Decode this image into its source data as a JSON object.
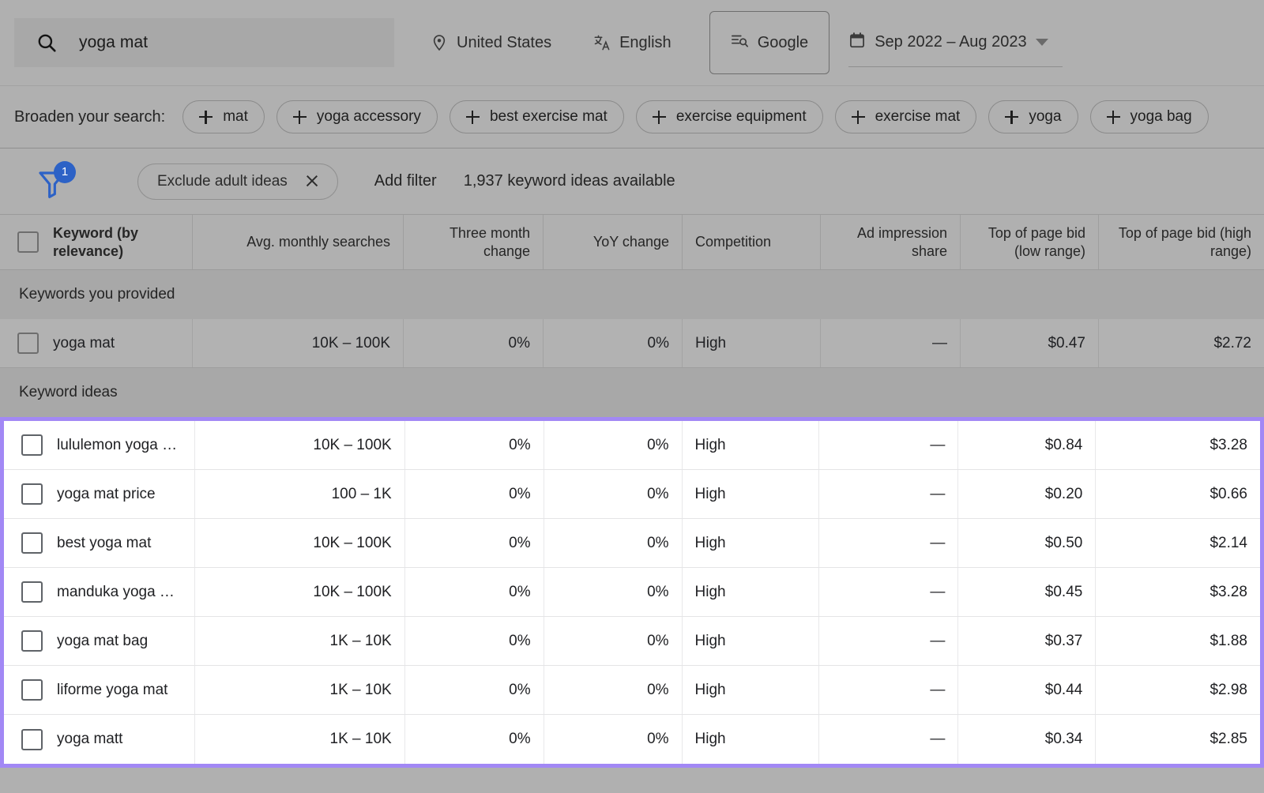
{
  "header": {
    "search": {
      "value": "yoga mat",
      "placeholder": "Enter a keyword",
      "icon": "search-icon"
    },
    "location": {
      "label": "United States",
      "icon": "location-pin-icon"
    },
    "language": {
      "label": "English",
      "icon": "translate-icon"
    },
    "engine": {
      "label": "Google",
      "icon": "search-network-icon"
    },
    "date_range": {
      "label": "Sep 2022 – Aug 2023",
      "icon": "calendar-icon",
      "caret": "chevron-down-icon"
    }
  },
  "broaden": {
    "label": "Broaden your search:",
    "chips": [
      "mat",
      "yoga accessory",
      "best exercise mat",
      "exercise equipment",
      "exercise mat",
      "yoga",
      "yoga bag"
    ]
  },
  "filters": {
    "funnel_icon": "filter-funnel-icon",
    "badge_count": "1",
    "active_chip": "Exclude adult ideas",
    "close_icon": "close-icon",
    "add_filter_label": "Add filter",
    "ideas_available": "1,937 keyword ideas available"
  },
  "table": {
    "columns": [
      "Keyword (by relevance)",
      "Avg. monthly searches",
      "Three month change",
      "YoY change",
      "Competition",
      "Ad impression share",
      "Top of page bid (low range)",
      "Top of page bid (high range)"
    ],
    "sections": [
      {
        "title": "Keywords you provided",
        "highlighted": false,
        "rows": [
          {
            "keyword": "yoga mat",
            "avg_monthly_searches": "10K – 100K",
            "three_month_change": "0%",
            "yoy_change": "0%",
            "competition": "High",
            "ad_impression_share": "—",
            "bid_low": "$0.47",
            "bid_high": "$2.72"
          }
        ]
      },
      {
        "title": "Keyword ideas",
        "highlighted": true,
        "rows": [
          {
            "keyword": "lululemon yoga …",
            "avg_monthly_searches": "10K – 100K",
            "three_month_change": "0%",
            "yoy_change": "0%",
            "competition": "High",
            "ad_impression_share": "—",
            "bid_low": "$0.84",
            "bid_high": "$3.28"
          },
          {
            "keyword": "yoga mat price",
            "avg_monthly_searches": "100 – 1K",
            "three_month_change": "0%",
            "yoy_change": "0%",
            "competition": "High",
            "ad_impression_share": "—",
            "bid_low": "$0.20",
            "bid_high": "$0.66"
          },
          {
            "keyword": "best yoga mat",
            "avg_monthly_searches": "10K – 100K",
            "three_month_change": "0%",
            "yoy_change": "0%",
            "competition": "High",
            "ad_impression_share": "—",
            "bid_low": "$0.50",
            "bid_high": "$2.14"
          },
          {
            "keyword": "manduka yoga …",
            "avg_monthly_searches": "10K – 100K",
            "three_month_change": "0%",
            "yoy_change": "0%",
            "competition": "High",
            "ad_impression_share": "—",
            "bid_low": "$0.45",
            "bid_high": "$3.28"
          },
          {
            "keyword": "yoga mat bag",
            "avg_monthly_searches": "1K – 10K",
            "three_month_change": "0%",
            "yoy_change": "0%",
            "competition": "High",
            "ad_impression_share": "—",
            "bid_low": "$0.37",
            "bid_high": "$1.88"
          },
          {
            "keyword": "liforme yoga mat",
            "avg_monthly_searches": "1K – 10K",
            "three_month_change": "0%",
            "yoy_change": "0%",
            "competition": "High",
            "ad_impression_share": "—",
            "bid_low": "$0.44",
            "bid_high": "$2.98"
          },
          {
            "keyword": "yoga matt",
            "avg_monthly_searches": "1K – 10K",
            "three_month_change": "0%",
            "yoy_change": "0%",
            "competition": "High",
            "ad_impression_share": "—",
            "bid_low": "$0.34",
            "bid_high": "$2.85"
          }
        ]
      }
    ]
  },
  "colors": {
    "page_bg": "#b0b0b0",
    "highlight_border": "#a288f5",
    "badge_blue": "#2d62c6",
    "row_white": "#ffffff"
  }
}
